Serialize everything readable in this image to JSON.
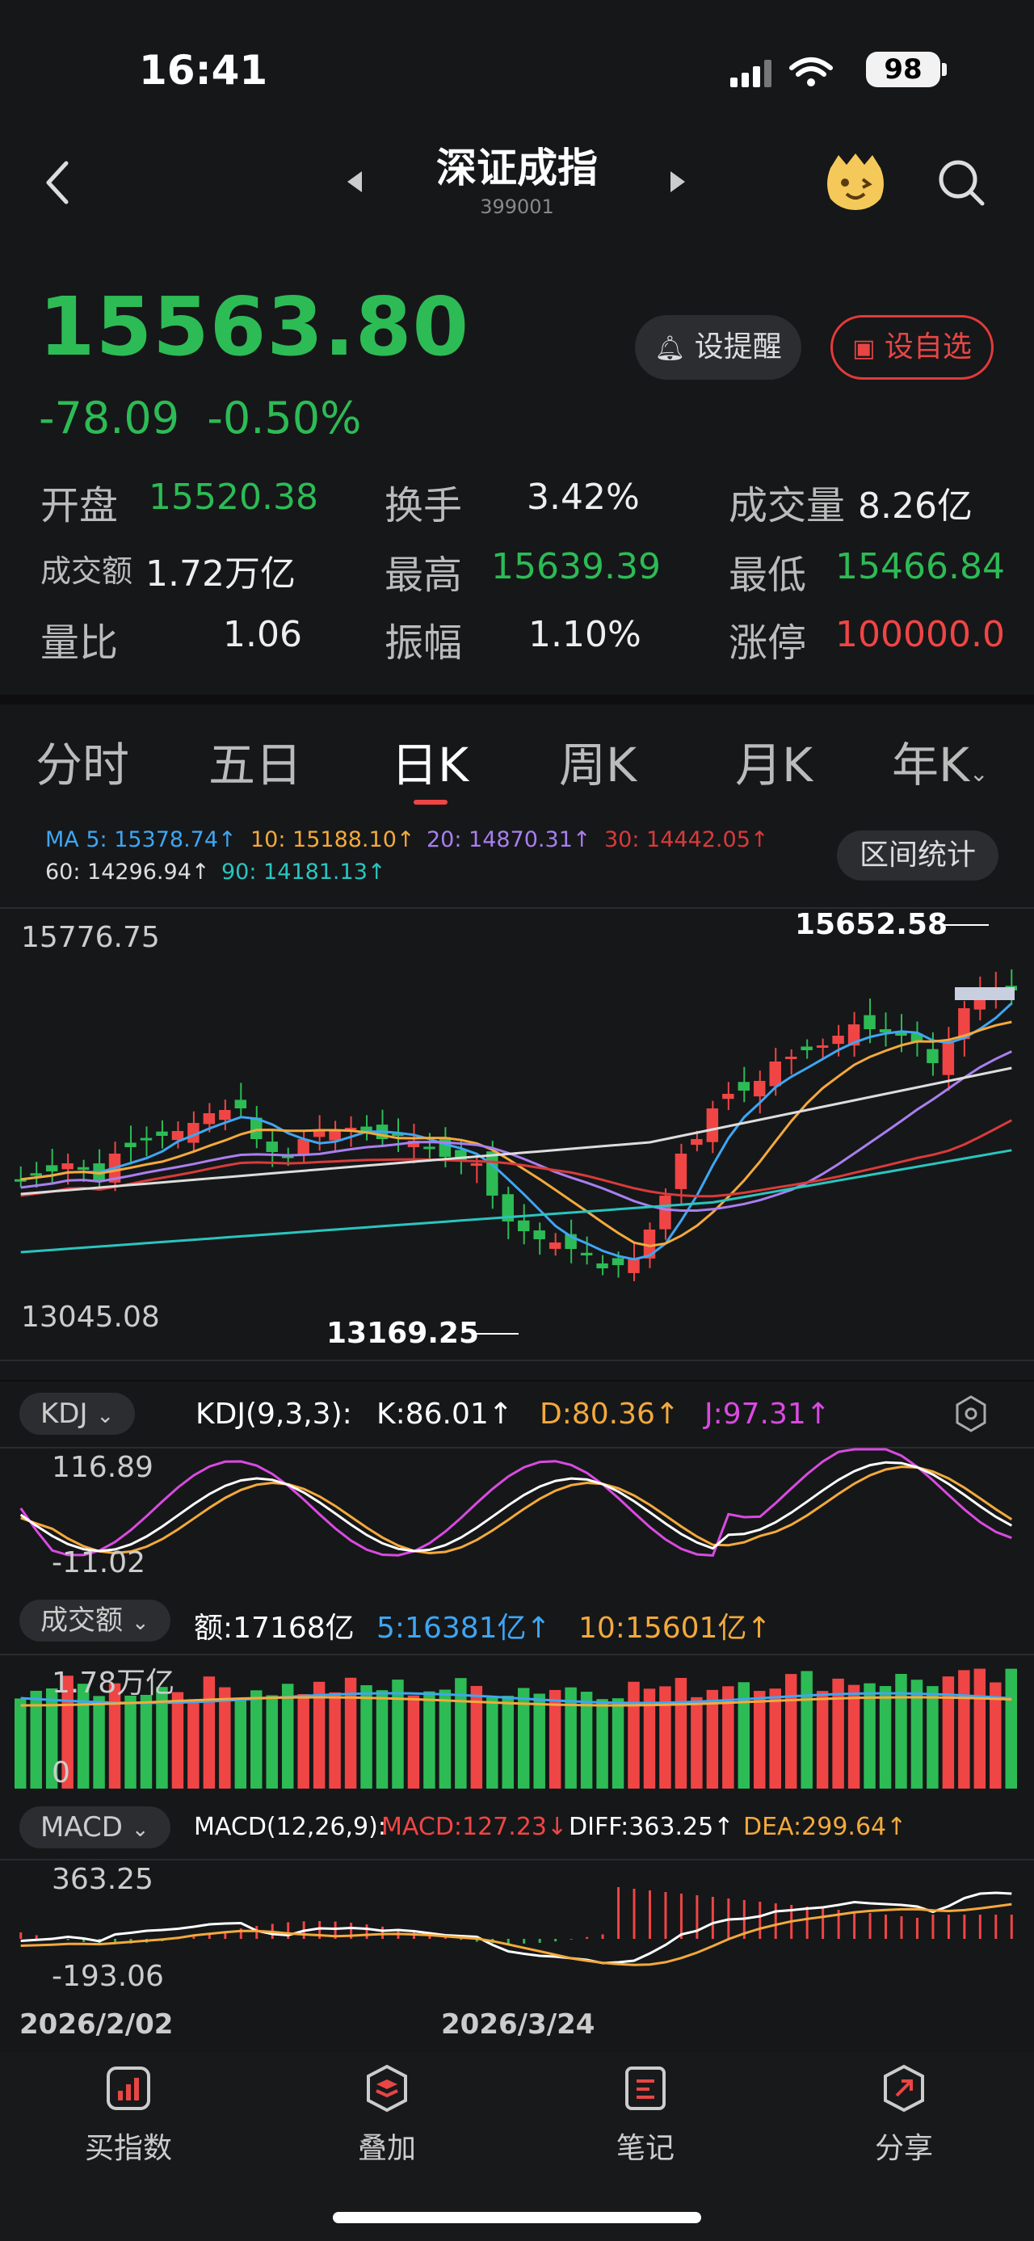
{
  "status": {
    "time": "16:41",
    "battery": "98"
  },
  "header": {
    "title": "深证成指",
    "code": "399001"
  },
  "quote": {
    "price": "15563.80",
    "change": "-78.09",
    "change_pct": "-0.50%",
    "alert_label": "设提醒",
    "watch_label": "设自选"
  },
  "stats": [
    {
      "label": "开盘",
      "value": "15520.38",
      "color": "green"
    },
    {
      "label": "换手",
      "value": "3.42%",
      "color": "white"
    },
    {
      "label": "成交量",
      "value": "8.26亿",
      "color": "white"
    },
    {
      "label": "成交额",
      "value": "1.72万亿",
      "color": "white"
    },
    {
      "label": "最高",
      "value": "15639.39",
      "color": "green"
    },
    {
      "label": "最低",
      "value": "15466.84",
      "color": "green"
    },
    {
      "label": "量比",
      "value": "1.06",
      "color": "white"
    },
    {
      "label": "振幅",
      "value": "1.10%",
      "color": "white"
    },
    {
      "label": "涨停",
      "value": "100000.0",
      "color": "red"
    }
  ],
  "tabs": [
    "分时",
    "五日",
    "日K",
    "周K",
    "月K",
    "年K"
  ],
  "active_tab": "日K",
  "ma": {
    "ma5": "MA 5: 15378.74↑",
    "ma10": "10: 15188.10↑",
    "ma20": "20: 14870.31↑",
    "ma30": "30: 14442.05↑",
    "ma60": "60: 14296.94↑",
    "ma90": "90: 14181.13↑",
    "range_stats": "区间统计"
  },
  "colors": {
    "ma5": "#3ea6f2",
    "ma10": "#f3a93b",
    "ma20": "#a97ff0",
    "ma30": "#d93a3a",
    "ma60": "#dddddd",
    "ma90": "#2bc5c0",
    "up": "#f04545",
    "down": "#2dbb55"
  },
  "kline": {
    "y_top": "15776.75",
    "y_bottom": "13045.08",
    "high_label": "15652.58",
    "low_label": "13169.25"
  },
  "kdj": {
    "selector": "KDJ",
    "params": "KDJ(9,3,3):",
    "k": "K:86.01↑",
    "d": "D:80.36↑",
    "j": "J:97.31↑",
    "y_top": "116.89",
    "y_bottom": "-11.02"
  },
  "amount": {
    "selector": "成交额",
    "value": "额:17168亿",
    "ma5": "5:16381亿↑",
    "ma10": "10:15601亿↑",
    "y_top": "1.78万亿",
    "y_bottom": "0"
  },
  "macd": {
    "selector": "MACD",
    "params": "MACD(12,26,9):",
    "macd": "MACD:127.23↓",
    "diff": "DIFF:363.25↑",
    "dea": "DEA:299.64↑",
    "y_top": "363.25",
    "y_bottom": "-193.06"
  },
  "dates": [
    "2026/2/02",
    "2026/3/24"
  ],
  "bottom_nav": [
    "买指数",
    "叠加",
    "笔记",
    "分享"
  ]
}
